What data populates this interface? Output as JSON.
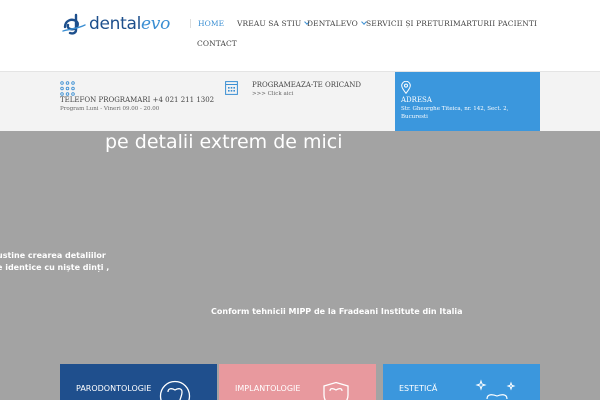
{
  "header": {
    "logo": {
      "brand_main": "dental",
      "brand_accent": "evo"
    },
    "nav": [
      {
        "label": "HOME",
        "active": true,
        "dropdown": false
      },
      {
        "label": "VREAU SA STIU",
        "active": false,
        "dropdown": true
      },
      {
        "label": "DENTALEVO",
        "active": false,
        "dropdown": true
      },
      {
        "label": "SERVICII ȘI PRETURI",
        "active": false,
        "dropdown": false
      },
      {
        "label": "MARTURII PACIENTI",
        "active": false,
        "dropdown": false
      },
      {
        "label": "CONTACT",
        "active": false,
        "dropdown": false
      }
    ]
  },
  "infobar": {
    "phone": {
      "icon": "dialpad-icon",
      "title": "TELEFON PROGRAMARI +4 021 211 1302",
      "sub": "Program Luni - Vineri 09.00 - 20.00"
    },
    "schedule": {
      "icon": "calendar-icon",
      "title": "PROGRAMEAZA-TE ORICAND",
      "link": ">>> Click aici"
    },
    "address": {
      "icon": "location-pin-icon",
      "title": "ADRESA",
      "line1": "Str. Gheorghe Titeica, nr. 142, Sect. 2,",
      "line2": "Bucuresti"
    }
  },
  "hero": {
    "heading": "pe detalii extrem de mici",
    "left_line1": "ustine crearea detaliilor",
    "left_line2": "e identice cu niște dinți ,",
    "caption": "Conform tehnicii MIPP de la Fradeani Institute din Italia"
  },
  "cards": [
    {
      "label": "PARODONTOLOGIE",
      "color": "#1f4f8d",
      "icon": "tooth-icon"
    },
    {
      "label": "IMPLANTOLOGIE",
      "color": "#e8999e",
      "icon": "shield-tooth-icon"
    },
    {
      "label": "ESTETICĂ",
      "color": "#3b97dd",
      "icon": "sparkle-tooth-icon"
    }
  ],
  "colors": {
    "accent": "#3b8fd3",
    "brand_dark": "#1d4f8c",
    "hero_gray": "#a3a3a3",
    "infobar_bg": "#f3f3f3"
  }
}
